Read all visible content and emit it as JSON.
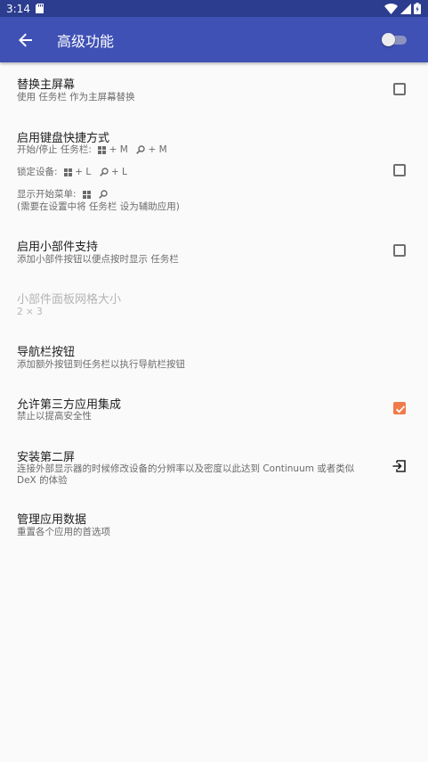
{
  "status_bar": {
    "time": "3:14",
    "icons": [
      "sd-card-icon",
      "wifi-icon",
      "signal-icon",
      "battery-charging-icon"
    ]
  },
  "app_bar": {
    "title": "高级功能",
    "back_icon": "arrow-back-icon",
    "master_toggle_on": false
  },
  "colors": {
    "status_bar": "#2c3d8f",
    "app_bar": "#3f51b5",
    "accent": "#f07a4a",
    "background": "#fafafa"
  },
  "settings": {
    "replace_home": {
      "title": "替换主屏幕",
      "summary": "使用 任务栏 作为主屏幕替换",
      "checked": false
    },
    "keyboard_shortcuts": {
      "title": "启用键盘快捷方式",
      "line1_label": "开始/停止 任务栏:",
      "line1_win_keys": "+ M",
      "line1_search_keys": "+ M",
      "line2_label": "锁定设备:",
      "line2_win_keys": "+ L",
      "line2_search_keys": "+ L",
      "line3_label": "显示开始菜单:",
      "line4": "(需要在设置中将 任务栏 设为辅助应用)",
      "checked": false
    },
    "widget_support": {
      "title": "启用小部件支持",
      "summary": "添加小部件按钮以便点按时显示 任务栏",
      "checked": false
    },
    "widget_grid": {
      "title": "小部件面板网格大小",
      "summary": "2 × 3",
      "enabled": false
    },
    "nav_buttons": {
      "title": "导航栏按钮",
      "summary": "添加额外按钮到任务栏以执行导航栏按钮"
    },
    "third_party": {
      "title": "允许第三方应用集成",
      "summary": "禁止以提高安全性",
      "checked": true
    },
    "second_screen": {
      "title": "安装第二屏",
      "summary_line1": "连接外部显示器的时候修改设备的分辨率以及密度以此达到 Continuum 或者类似",
      "summary_line2": "DeX 的体验",
      "icon": "open-in-app-icon"
    },
    "manage_data": {
      "title": "管理应用数据",
      "summary": "重置各个应用的首选项"
    }
  }
}
